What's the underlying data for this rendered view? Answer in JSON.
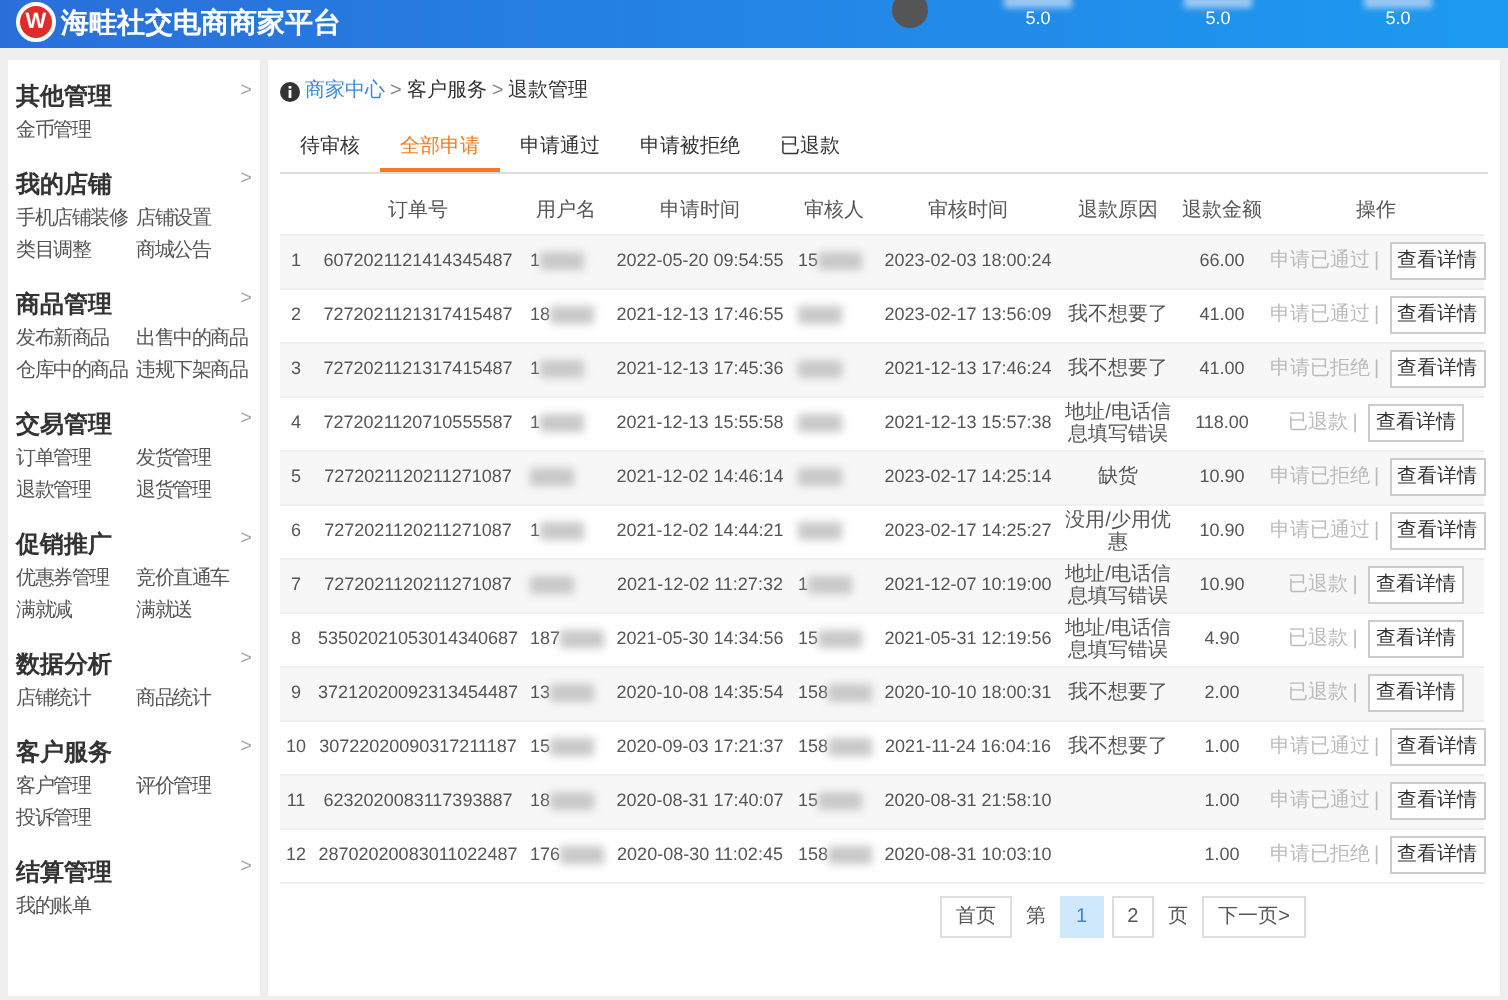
{
  "header": {
    "logo_letter": "W",
    "title": "海畦社交电商商家平台",
    "ratings": [
      {
        "value": "5.0"
      },
      {
        "value": "5.0"
      },
      {
        "value": "5.0"
      }
    ]
  },
  "sidebar": {
    "sections": [
      {
        "title": "其他管理",
        "chevron": ">",
        "links": [
          "金币管理"
        ]
      },
      {
        "title": "我的店铺",
        "chevron": ">",
        "links": [
          "手机店铺装修",
          "店铺设置",
          "类目调整",
          "商城公告"
        ]
      },
      {
        "title": "商品管理",
        "chevron": ">",
        "links": [
          "发布新商品",
          "出售中的商品",
          "仓库中的商品",
          "违规下架商品"
        ]
      },
      {
        "title": "交易管理",
        "chevron": ">",
        "links": [
          "订单管理",
          "发货管理",
          "退款管理",
          "退货管理"
        ]
      },
      {
        "title": "促销推广",
        "chevron": ">",
        "links": [
          "优惠券管理",
          "竞价直通车",
          "满就减",
          "满就送"
        ]
      },
      {
        "title": "数据分析",
        "chevron": ">",
        "links": [
          "店铺统计",
          "商品统计"
        ]
      },
      {
        "title": "客户服务",
        "chevron": ">",
        "links": [
          "客户管理",
          "评价管理",
          "投诉管理"
        ]
      },
      {
        "title": "结算管理",
        "chevron": ">",
        "links": [
          "我的账单"
        ]
      }
    ]
  },
  "breadcrumb": [
    {
      "label": "商家中心",
      "kind": "link"
    },
    {
      "label": ">",
      "kind": "sep"
    },
    {
      "label": "客户服务",
      "kind": "text"
    },
    {
      "label": ">",
      "kind": "sep"
    },
    {
      "label": "退款管理",
      "kind": "text"
    }
  ],
  "tabs": [
    {
      "label": "待审核",
      "selected": false
    },
    {
      "label": "全部申请",
      "selected": true
    },
    {
      "label": "申请通过",
      "selected": false
    },
    {
      "label": "申请被拒绝",
      "selected": false
    },
    {
      "label": "已退款",
      "selected": false
    }
  ],
  "table": {
    "columns": [
      "订单号",
      "用户名",
      "申请时间",
      "审核人",
      "审核时间",
      "退款原因",
      "退款金额",
      "操作"
    ],
    "rows": [
      {
        "index": "1",
        "order": "6072021121414345487",
        "user": "1",
        "apply_time": "2022-05-20 09:54:55",
        "reviewer": "15",
        "review_time": "2023-02-03 18:00:24",
        "amount": "66.00",
        "status": "申请已通过",
        "separator": "|",
        "action": "查看详情"
      },
      {
        "index": "2",
        "order": "7272021121317415487",
        "user": "18",
        "apply_time": "2021-12-13 17:46:55",
        "review_time": "2023-02-17 13:56:09",
        "reason": "我不想要了",
        "amount": "41.00",
        "status": "申请已通过",
        "separator": "|",
        "action": "查看详情"
      },
      {
        "index": "3",
        "order": "7272021121317415487",
        "user": "1",
        "apply_time": "2021-12-13 17:45:36",
        "review_time": "2021-12-13 17:46:24",
        "reason": "我不想要了",
        "amount": "41.00",
        "status": "申请已拒绝",
        "separator": "|",
        "action": "查看详情"
      },
      {
        "index": "4",
        "order": "7272021120710555587",
        "user": "1",
        "apply_time": "2021-12-13 15:55:58",
        "review_time": "2021-12-13 15:57:38",
        "reason": "地址/电话信息填写错误",
        "amount": "118.00",
        "status": "已退款",
        "separator": "|",
        "action": "查看详情"
      },
      {
        "index": "5",
        "order": "7272021120211271087",
        "apply_time": "2021-12-02 14:46:14",
        "review_time": "2023-02-17 14:25:14",
        "reason": "缺货",
        "amount": "10.90",
        "status": "申请已拒绝",
        "separator": "|",
        "action": "查看详情"
      },
      {
        "index": "6",
        "order": "7272021120211271087",
        "user": "1",
        "apply_time": "2021-12-02 14:44:21",
        "review_time": "2023-02-17 14:25:27",
        "reason": "没用/少用优惠",
        "amount": "10.90",
        "status": "申请已通过",
        "separator": "|",
        "action": "查看详情"
      },
      {
        "index": "7",
        "order": "7272021120211271087",
        "apply_time": "2021-12-02 11:27:32",
        "reviewer": "1",
        "review_time": "2021-12-07 10:19:00",
        "reason": "地址/电话信息填写错误",
        "amount": "10.90",
        "status": "已退款",
        "separator": "|",
        "action": "查看详情"
      },
      {
        "index": "8",
        "order": "53502021053014340687",
        "user": "187",
        "apply_time": "2021-05-30 14:34:56",
        "reviewer": "15",
        "review_time": "2021-05-31 12:19:56",
        "reason": "地址/电话信息填写错误",
        "amount": "4.90",
        "status": "已退款",
        "separator": "|",
        "action": "查看详情"
      },
      {
        "index": "9",
        "order": "37212020092313454487",
        "user": "13",
        "apply_time": "2020-10-08 14:35:54",
        "reviewer": "158",
        "review_time": "2020-10-10 18:00:31",
        "reason": "我不想要了",
        "amount": "2.00",
        "status": "已退款",
        "separator": "|",
        "action": "查看详情"
      },
      {
        "index": "10",
        "order": "30722020090317211187",
        "user": "15",
        "apply_time": "2020-09-03 17:21:37",
        "reviewer": "158",
        "review_time": "2021-11-24 16:04:16",
        "reason": "我不想要了",
        "amount": "1.00",
        "status": "申请已通过",
        "separator": "|",
        "action": "查看详情"
      },
      {
        "index": "11",
        "order": "6232020083117393887",
        "user": "18",
        "apply_time": "2020-08-31 17:40:07",
        "reviewer": "15",
        "review_time": "2020-08-31 21:58:10",
        "amount": "1.00",
        "status": "申请已通过",
        "separator": "|",
        "action": "查看详情"
      },
      {
        "index": "12",
        "order": "28702020083011022487",
        "user": "176",
        "apply_time": "2020-08-30 11:02:45",
        "reviewer": "158",
        "review_time": "2020-08-31 10:03:10",
        "amount": "1.00",
        "status": "申请已拒绝",
        "separator": "|",
        "action": "查看详情"
      }
    ]
  },
  "pagination": {
    "first": "首页",
    "page_prefix": "第",
    "pages": [
      {
        "label": "1",
        "selected": true
      },
      {
        "label": "2",
        "selected": false
      }
    ],
    "page_suffix": "页",
    "next": "下一页>"
  }
}
